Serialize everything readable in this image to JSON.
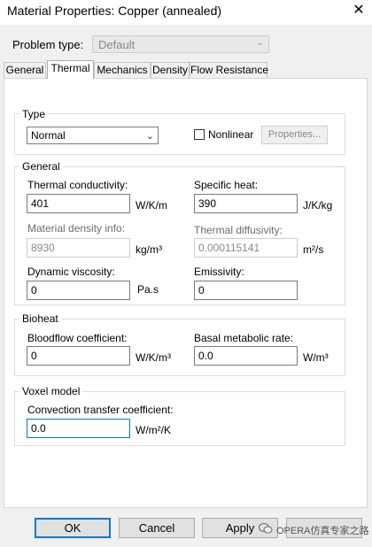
{
  "window": {
    "title": "Material Properties: Copper (annealed)",
    "close_glyph": "✕"
  },
  "problem_type": {
    "label": "Problem type:",
    "value": "Default"
  },
  "tabs": [
    {
      "label": "General"
    },
    {
      "label": "Thermal"
    },
    {
      "label": "Mechanics"
    },
    {
      "label": "Density"
    },
    {
      "label": "Flow Resistance"
    }
  ],
  "type_group": {
    "title": "Type",
    "select_value": "Normal",
    "nonlinear_label": "Nonlinear",
    "nonlinear_checked": false,
    "properties_button": "Properties..."
  },
  "general_group": {
    "title": "General",
    "thermal_conductivity": {
      "label": "Thermal conductivity:",
      "value": "401",
      "unit": "W/K/m"
    },
    "specific_heat": {
      "label": "Specific heat:",
      "value": "390",
      "unit": "J/K/kg"
    },
    "material_density": {
      "label": "Material density info:",
      "value": "8930",
      "unit": "kg/m³"
    },
    "thermal_diffusivity": {
      "label": "Thermal diffusivity:",
      "value": "0.000115141",
      "unit": "m²/s"
    },
    "dynamic_viscosity": {
      "label": "Dynamic viscosity:",
      "value": "0",
      "unit": "Pa.s"
    },
    "emissivity": {
      "label": "Emissivity:",
      "value": "0"
    }
  },
  "bioheat_group": {
    "title": "Bioheat",
    "bloodflow": {
      "label": "Bloodflow coefficient:",
      "value": "0",
      "unit": "W/K/m³"
    },
    "basal": {
      "label": "Basal metabolic rate:",
      "value": "0.0",
      "unit": "W/m³"
    }
  },
  "voxel_group": {
    "title": "Voxel model",
    "convection": {
      "label": "Convection transfer coefficient:",
      "value": "0.0",
      "unit": "W/m²/K"
    }
  },
  "buttons": {
    "ok": "OK",
    "cancel": "Cancel",
    "apply": "Apply"
  },
  "watermark": "OPERA仿真专家之路",
  "colors": {
    "focus_border": "#0078d7",
    "panel_bg": "#ffffff",
    "dialog_bg": "#f0f0f0"
  }
}
